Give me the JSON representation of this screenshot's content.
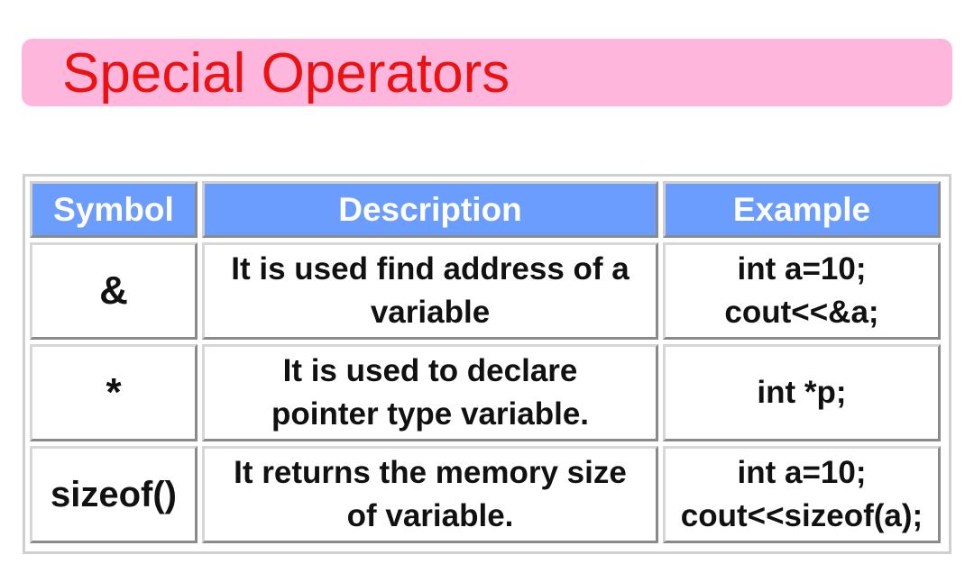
{
  "title": "Special Operators",
  "colors": {
    "banner_bg": "#ffb6dc",
    "title_text": "#ee1111",
    "header_bg": "#6b9dff",
    "header_text": "#ffffff"
  },
  "table": {
    "headers": [
      "Symbol",
      "Description",
      "Example"
    ],
    "rows": [
      {
        "symbol": "&",
        "description": [
          "It is used find address of a",
          "variable"
        ],
        "example": [
          "int a=10;",
          "cout<<&a;"
        ]
      },
      {
        "symbol": "*",
        "description": [
          "It is used to declare",
          "pointer type variable."
        ],
        "example": [
          "int *p;"
        ]
      },
      {
        "symbol": "sizeof()",
        "description": [
          "It returns the memory size",
          "of variable."
        ],
        "example": [
          "int a=10;",
          "cout<<sizeof(a);"
        ]
      }
    ]
  }
}
